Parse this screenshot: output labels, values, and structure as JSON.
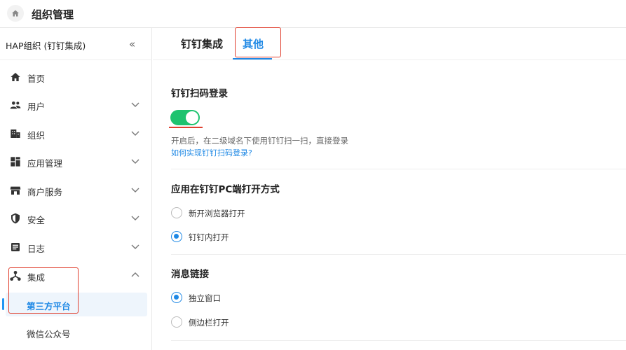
{
  "topbar": {
    "title": "组织管理",
    "home_icon": "home-icon"
  },
  "sidebar": {
    "org_name": "HAP组织 (钉钉集成)",
    "collapse_glyph": "«",
    "items": [
      {
        "label": "首页",
        "icon": "home-icon"
      },
      {
        "label": "用户",
        "icon": "users-icon"
      },
      {
        "label": "组织",
        "icon": "building-icon"
      },
      {
        "label": "应用管理",
        "icon": "apps-icon"
      },
      {
        "label": "商户服务",
        "icon": "store-icon"
      },
      {
        "label": "安全",
        "icon": "shield-icon"
      },
      {
        "label": "日志",
        "icon": "log-icon"
      },
      {
        "label": "集成",
        "icon": "integration-icon",
        "expanded": true
      }
    ],
    "sub_items": [
      {
        "label": "第三方平台",
        "active": true
      },
      {
        "label": "微信公众号",
        "active": false
      }
    ]
  },
  "tabs": [
    {
      "label": "钉钉集成",
      "active": false
    },
    {
      "label": "其他",
      "active": true
    }
  ],
  "main": {
    "qr_login": {
      "title": "钉钉扫码登录",
      "enabled": true,
      "description": "开启后，在二级域名下使用钉钉扫一扫，直接登录",
      "help_link": "如何实现钉钉扫码登录?"
    },
    "open_mode": {
      "title": "应用在钉钉PC端打开方式",
      "options": [
        {
          "label": "新开浏览器打开",
          "checked": false
        },
        {
          "label": "钉钉内打开",
          "checked": true
        }
      ]
    },
    "message_link": {
      "title": "消息链接",
      "options": [
        {
          "label": "独立窗口",
          "checked": true
        },
        {
          "label": "侧边栏打开",
          "checked": false
        }
      ]
    }
  },
  "colors": {
    "accent": "#1e88e5",
    "toggle_on": "#1ec36f",
    "highlight": "#e0402f"
  }
}
